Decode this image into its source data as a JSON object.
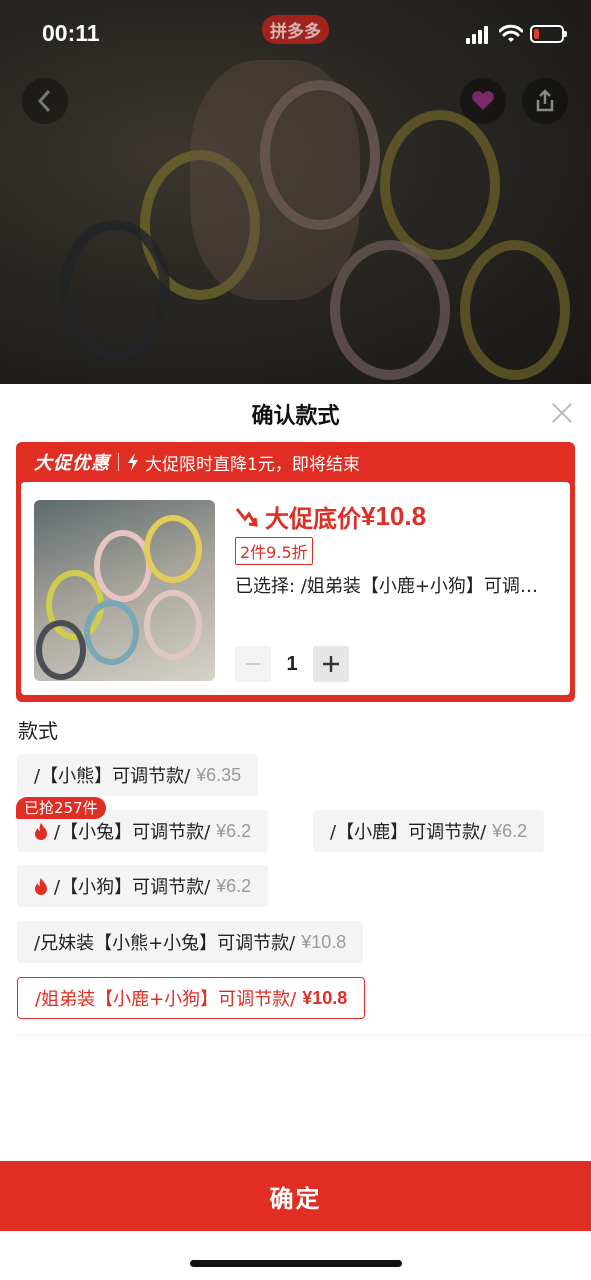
{
  "status_bar": {
    "time": "00:11",
    "brand": "拼多多"
  },
  "sheet": {
    "title": "确认款式",
    "promo": {
      "tag": "大促优惠",
      "text": "大促限时直降1元，即将结束",
      "price_label": "大促底价",
      "price": "¥10.8",
      "discount": "2件9.5折",
      "selected": "已选择: /姐弟装【小鹿+小狗】可调节款/"
    },
    "quantity": {
      "minus": "−",
      "value": "1",
      "plus": "+"
    },
    "section_label": "款式",
    "options": [
      {
        "name": "/【小熊】可调节款/",
        "price": "¥6.35"
      },
      {
        "name": "/【小兔】可调节款/",
        "price": "¥6.2",
        "badge": "已抢257件"
      },
      {
        "name": "/【小鹿】可调节款/",
        "price": "¥6.2"
      },
      {
        "name": "/【小狗】可调节款/",
        "price": "¥6.2"
      },
      {
        "name": "/兄妹装【小熊+小兔】可调节款/",
        "price": "¥10.8"
      },
      {
        "name": "/姐弟装【小鹿+小狗】可调节款/",
        "price": "¥10.8"
      }
    ],
    "confirm_label": "确定"
  },
  "colors": {
    "accent": "#e02e24",
    "option_bg": "#f4f4f4",
    "muted_price": "#999999"
  },
  "icons": [
    "chevron-left-icon",
    "share-icon",
    "close-icon",
    "lightning-icon",
    "arrow-down-icon",
    "flame-icon",
    "signal-icon",
    "wifi-icon",
    "battery-icon"
  ]
}
